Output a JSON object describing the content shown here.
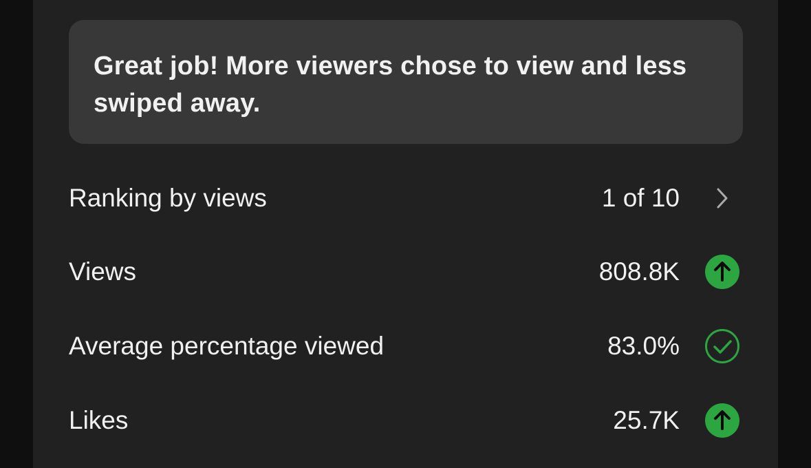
{
  "feedback": {
    "message": "Great job! More viewers chose to view and less swiped away."
  },
  "metrics": {
    "ranking": {
      "label": "Ranking by views",
      "value": "1 of 10",
      "icon": "chevron-right-icon"
    },
    "views": {
      "label": "Views",
      "value": "808.8K",
      "icon": "arrow-up-circle-icon"
    },
    "avg_percentage_viewed": {
      "label": "Average percentage viewed",
      "value": "83.0%",
      "icon": "check-circle-icon"
    },
    "likes": {
      "label": "Likes",
      "value": "25.7K",
      "icon": "arrow-up-circle-icon"
    }
  },
  "colors": {
    "background": "#0f0f0f",
    "panel": "#212121",
    "card": "#383838",
    "text": "#f1f1f1",
    "positive": "#2ba640",
    "chevron": "#aaaaaa"
  }
}
